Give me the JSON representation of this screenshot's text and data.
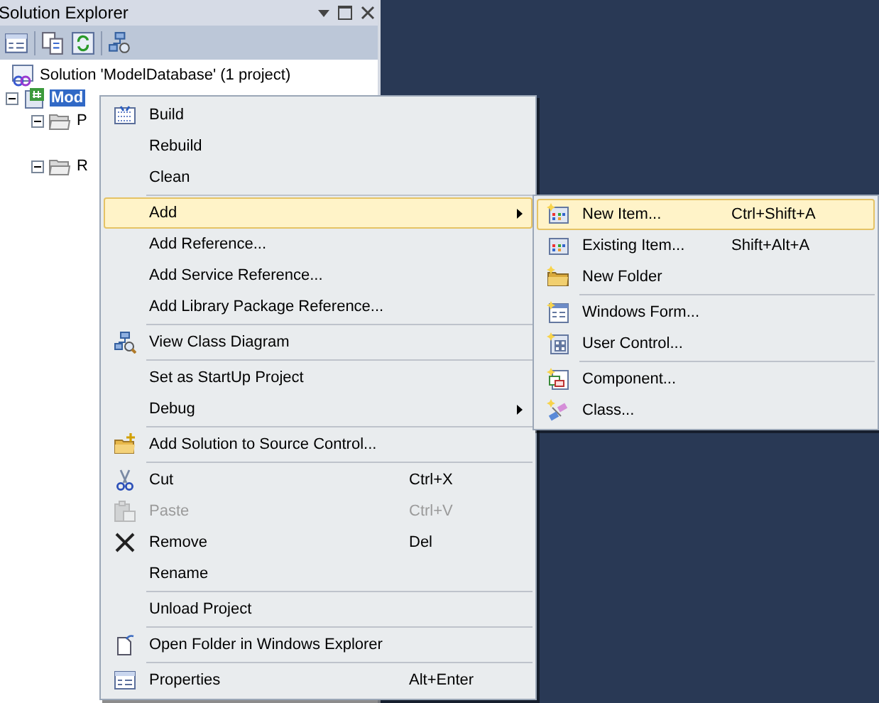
{
  "panel": {
    "title": "Solution Explorer"
  },
  "tree": [
    {
      "label": "Solution 'ModelDatabase' (1 project)",
      "selected": false,
      "children": [
        {
          "label": "Mod",
          "selected": true,
          "expanded": true,
          "children": [
            {
              "label": "P",
              "selected": false,
              "expanded": true
            },
            {
              "label": "R",
              "selected": false,
              "expanded": true
            }
          ]
        }
      ]
    }
  ],
  "context_menu": [
    {
      "kind": "item",
      "label": "Build",
      "selected": false
    },
    {
      "kind": "item",
      "label": "Rebuild",
      "selected": false
    },
    {
      "kind": "item",
      "label": "Clean",
      "selected": false
    },
    {
      "kind": "separator"
    },
    {
      "kind": "item",
      "label": "Add",
      "selected": true,
      "submenu": true
    },
    {
      "kind": "item",
      "label": "Add Reference...",
      "selected": false
    },
    {
      "kind": "item",
      "label": "Add Service Reference...",
      "selected": false
    },
    {
      "kind": "item",
      "label": "Add Library Package Reference...",
      "selected": false
    },
    {
      "kind": "separator"
    },
    {
      "kind": "item",
      "label": "View Class Diagram",
      "selected": false
    },
    {
      "kind": "separator"
    },
    {
      "kind": "item",
      "label": "Set as StartUp Project",
      "selected": false
    },
    {
      "kind": "item",
      "label": "Debug",
      "selected": false,
      "submenu": true
    },
    {
      "kind": "separator"
    },
    {
      "kind": "item",
      "label": "Add Solution to Source Control...",
      "selected": false
    },
    {
      "kind": "separator"
    },
    {
      "kind": "item",
      "label": "Cut",
      "shortcut": "Ctrl+X",
      "selected": false
    },
    {
      "kind": "item",
      "label": "Paste",
      "shortcut": "Ctrl+V",
      "selected": false,
      "disabled": true
    },
    {
      "kind": "item",
      "label": "Remove",
      "shortcut": "Del",
      "selected": false
    },
    {
      "kind": "item",
      "label": "Rename",
      "selected": false
    },
    {
      "kind": "separator"
    },
    {
      "kind": "item",
      "label": "Unload Project",
      "selected": false
    },
    {
      "kind": "separator"
    },
    {
      "kind": "item",
      "label": "Open Folder in Windows Explorer",
      "selected": false
    },
    {
      "kind": "separator"
    },
    {
      "kind": "item",
      "label": "Properties",
      "shortcut": "Alt+Enter",
      "selected": false
    }
  ],
  "submenu": [
    {
      "kind": "item",
      "label": "New Item...",
      "shortcut": "Ctrl+Shift+A",
      "selected": true
    },
    {
      "kind": "item",
      "label": "Existing Item...",
      "shortcut": "Shift+Alt+A",
      "selected": false
    },
    {
      "kind": "item",
      "label": "New Folder",
      "selected": false
    },
    {
      "kind": "separator"
    },
    {
      "kind": "item",
      "label": "Windows Form...",
      "selected": false
    },
    {
      "kind": "item",
      "label": "User Control...",
      "selected": false
    },
    {
      "kind": "separator"
    },
    {
      "kind": "item",
      "label": "Component...",
      "selected": false
    },
    {
      "kind": "item",
      "label": "Class...",
      "selected": false
    }
  ]
}
